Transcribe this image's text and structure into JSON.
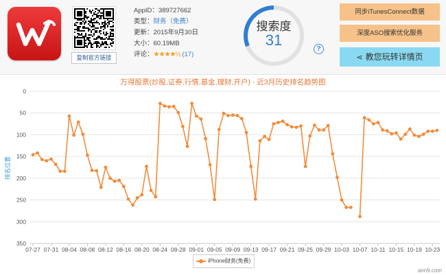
{
  "app": {
    "appid_label": "AppID：",
    "appid": "389727662",
    "type_label": "类型：",
    "type": "财务（免费）",
    "update_label": "更新：",
    "update": "2015年9月30日",
    "size_label": "大小：",
    "size": "60.19MB",
    "rating_label": "评论：",
    "stars": "★★★★½",
    "rating_count": "(17)",
    "qr_button": "复制官方链接"
  },
  "search_index": {
    "label": "搜索度",
    "value": "31",
    "fraction": 0.31
  },
  "actions": {
    "btn1": "同步iTunesConnect数据",
    "btn2": "深度ASO搜索优化服务",
    "btn3": "教您玩转详情页"
  },
  "colors": {
    "series": "#f08c3c",
    "title": "#e8773a",
    "gauge": "#2d7fd1",
    "ylabel": "#3b9ad9"
  },
  "chart_data": {
    "type": "line",
    "title": "万得股票(炒股,证券,行情,基金,理财,开户) - 近3月历史排名趋势图",
    "xlabel": "",
    "ylabel": "排名位置",
    "ylim": [
      0,
      350
    ],
    "y_inverted": true,
    "yticks": [
      0,
      50,
      100,
      150,
      200,
      250,
      300,
      350
    ],
    "xticks": [
      "07-27",
      "07-31",
      "08-04",
      "08-08",
      "08-12",
      "08-16",
      "08-20",
      "08-24",
      "08-28",
      "09-01",
      "09-05",
      "09-09",
      "09-13",
      "09-17",
      "09-21",
      "09-25",
      "09-29",
      "10-03",
      "10-07",
      "10-11",
      "10-15",
      "10-19",
      "10-23"
    ],
    "grid": true,
    "legend": "bottom-center",
    "series": [
      {
        "name": "iPhone财务(免费)",
        "values": [
          146,
          142,
          157,
          160,
          156,
          168,
          184,
          184,
          57,
          101,
          71,
          99,
          147,
          182,
          183,
          221,
          175,
          200,
          207,
          205,
          219,
          248,
          262,
          245,
          238,
          173,
          228,
          243,
          28,
          34,
          36,
          35,
          49,
          81,
          127,
          28,
          57,
          64,
          109,
          169,
          249,
          88,
          51,
          56,
          55,
          56,
          63,
          95,
          173,
          248,
          114,
          104,
          111,
          75,
          72,
          69,
          77,
          82,
          83,
          80,
          173,
          103,
          78,
          89,
          89,
          79,
          144,
          198,
          250,
          267,
          267,
          null,
          288,
          61,
          66,
          75,
          72,
          89,
          91,
          98,
          96,
          110,
          99,
          87,
          101,
          104,
          99,
          92,
          92,
          90
        ]
      }
    ]
  },
  "watermark": "ann9.com"
}
